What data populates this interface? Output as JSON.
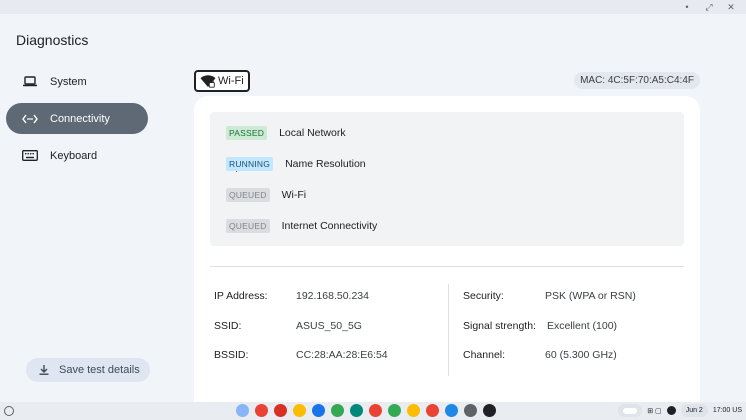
{
  "window": {
    "controls": [
      "•",
      "⤢",
      "✕"
    ]
  },
  "app": {
    "title": "Diagnostics"
  },
  "sidebar": {
    "items": [
      {
        "label": "System",
        "icon": "laptop-icon"
      },
      {
        "label": "Connectivity",
        "icon": "connectivity-arrows-icon",
        "active": true
      },
      {
        "label": "Keyboard",
        "icon": "keyboard-icon"
      }
    ],
    "save_label": "Save test details"
  },
  "network": {
    "tab_label": "Wi-Fi",
    "mac": "MAC: 4C:5F:70:A5:C4:4F"
  },
  "routines": [
    {
      "status": "PASSED",
      "name": "Local Network"
    },
    {
      "status": "RUNNING",
      "name": "Name Resolution"
    },
    {
      "status": "QUEUED",
      "name": "Wi-Fi"
    },
    {
      "status": "QUEUED",
      "name": "Internet Connectivity"
    }
  ],
  "properties": {
    "left": [
      {
        "label": "IP Address:",
        "value": "192.168.50.234"
      },
      {
        "label": "SSID:",
        "value": "ASUS_50_5G"
      },
      {
        "label": "BSSID:",
        "value": "CC:28:AA:28:E6:54"
      }
    ],
    "right": [
      {
        "label": "Security:",
        "value": "PSK (WPA or RSN)"
      },
      {
        "label": "Signal strength:",
        "value": "Excellent (100)"
      },
      {
        "label": "Channel:",
        "value": "60 (5.300 GHz)"
      }
    ]
  },
  "shelf": {
    "apps": [
      "#8ab4f8",
      "#ea4335",
      "#d93025",
      "#fbbc04",
      "#1a73e8",
      "#34a853",
      "#00897b",
      "#ea4335",
      "#34a853",
      "#fbbc04",
      "#ea4335",
      "#1e88e5",
      "#5f6368",
      "#202124"
    ],
    "date": "Jun 2",
    "time": "17:00 US"
  }
}
